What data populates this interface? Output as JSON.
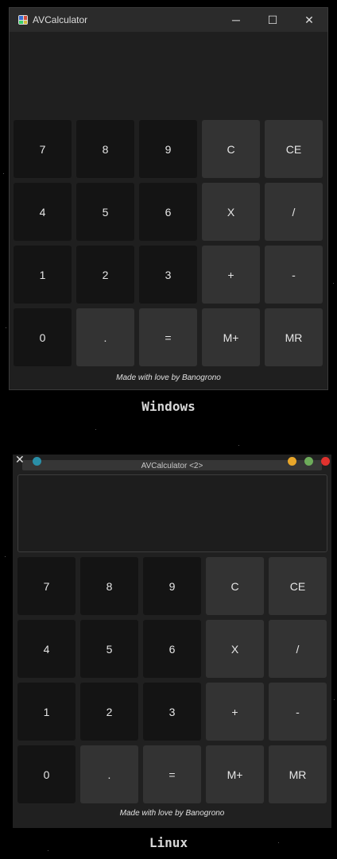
{
  "windows": {
    "title": "AVCalculator",
    "controls": {
      "minimize": "─",
      "maximize": "☐",
      "close": "✕"
    },
    "display_value": "",
    "footer": "Made with love by Banogrono",
    "caption": "Windows"
  },
  "linux": {
    "title": "AVCalculator <2>",
    "close_glyph": "✕",
    "display_value": "",
    "footer": "Made with love by Banogrono",
    "caption": "Linux"
  },
  "keypad": {
    "rows": [
      [
        "7",
        "8",
        "9",
        "C",
        "CE"
      ],
      [
        "4",
        "5",
        "6",
        "X",
        "/"
      ],
      [
        "1",
        "2",
        "3",
        "+",
        "-"
      ],
      [
        "0",
        ".",
        "=",
        "M+",
        "MR"
      ]
    ]
  },
  "colors": {
    "window_bg": "#1f1f1f",
    "digit_button": "#141414",
    "operator_button": "#333333",
    "dot_teal": "#2a8fa8",
    "dot_orange": "#e8a62a",
    "dot_green": "#6dab5a",
    "dot_red": "#e0322e"
  }
}
